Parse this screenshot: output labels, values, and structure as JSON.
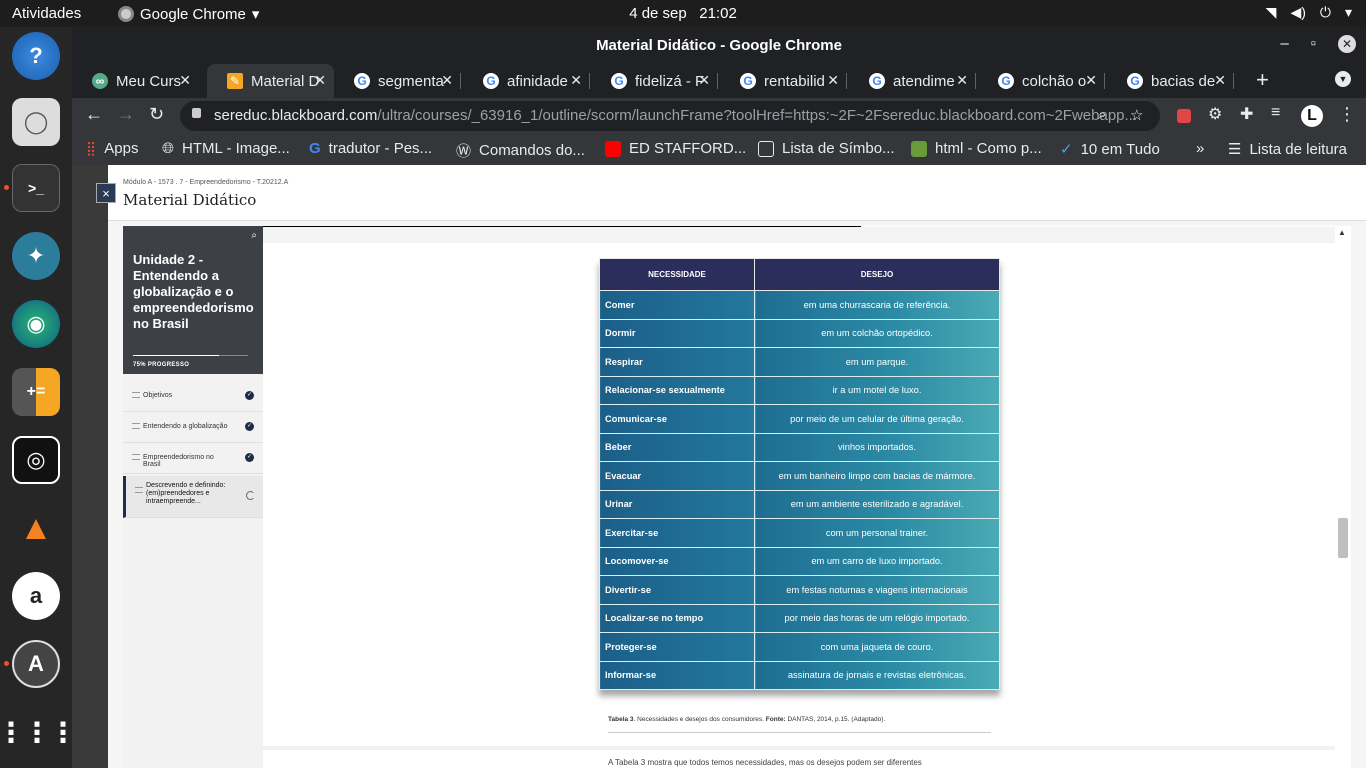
{
  "system": {
    "activities": "Atividades",
    "app_name": "Google Chrome",
    "date": "4 de sep",
    "time": "21:02"
  },
  "window": {
    "title": "Material Didático - Google Chrome"
  },
  "tabs": [
    {
      "label": "Meu Curs"
    },
    {
      "label": "Material D"
    },
    {
      "label": "segmenta"
    },
    {
      "label": "afinidade"
    },
    {
      "label": "fidelizá - F"
    },
    {
      "label": "rentabilid"
    },
    {
      "label": "atendime"
    },
    {
      "label": "colchão o"
    },
    {
      "label": "bacias de"
    }
  ],
  "address": {
    "domain": "sereduc.blackboard.com",
    "path": "/ultra/courses/_63916_1/outline/scorm/launchFrame?toolHref=https:~2F~2Fsereduc.blackboard.com~2Fwebapp..."
  },
  "bookmarks": {
    "apps": "Apps",
    "items": [
      {
        "label": "HTML - Image..."
      },
      {
        "label": "tradutor - Pes..."
      },
      {
        "label": "Comandos do..."
      },
      {
        "label": "ED STAFFORD..."
      },
      {
        "label": "Lista de Símbo..."
      },
      {
        "label": "html - Como p..."
      },
      {
        "label": "10 em Tudo"
      }
    ],
    "overflow": "»",
    "reading_list": "Lista de leitura"
  },
  "panel": {
    "breadcrumb": "Módulo A - 1573 . 7 - Empreendedorismo - T.20212.A",
    "title": "Material Didático",
    "close": "×"
  },
  "sidebar": {
    "unit_title": "Unidade 2 - Entendendo a globalização e o empreendedorismo no Brasil",
    "progress_label": "75% PROGRESSO",
    "progress": 0.75,
    "items": [
      {
        "label": "Objetivos",
        "status": "done"
      },
      {
        "label": "Entendendo a globalização",
        "status": "done"
      },
      {
        "label": "Empreendedorismo no Brasil",
        "status": "done"
      },
      {
        "label": "Descrevendo e definindo: (em)preendedores e intraempreende...",
        "status": "in-progress"
      }
    ]
  },
  "table": {
    "headers": [
      "NECESSIDADE",
      "DESEJO"
    ],
    "rows": [
      [
        "Comer",
        "em uma churrascaria de referência."
      ],
      [
        "Dormir",
        "em um colchão ortopédico."
      ],
      [
        "Respirar",
        "em um parque."
      ],
      [
        "Relacionar-se sexualmente",
        "ir a um motel de luxo."
      ],
      [
        "Comunicar-se",
        "por meio de um celular de última geração."
      ],
      [
        "Beber",
        "vinhos importados."
      ],
      [
        "Evacuar",
        "em um banheiro limpo com bacias de mármore."
      ],
      [
        "Urinar",
        "em um ambiente esterilizado e agradável."
      ],
      [
        "Exercitar-se",
        "com um personal trainer."
      ],
      [
        "Locomover-se",
        "em um carro de luxo importado."
      ],
      [
        "Divertir-se",
        "em festas noturnas e viagens internacionais"
      ],
      [
        "Localizar-se no tempo",
        "por meio das horas de um relógio importado."
      ],
      [
        "Proteger-se",
        "com uma jaqueta de couro."
      ],
      [
        "Informar-se",
        "assinatura de jornais e revistas eletrônicas."
      ]
    ],
    "caption_label": "Tabela 3",
    "caption_text": ". Necessidades e desejos dos consumidores. ",
    "caption_source_label": "Fonte:",
    "caption_source": " DANTAS, 2014, p.15. (Adaptado)."
  },
  "body_text": "A Tabela 3 mostra que todos temos necessidades, mas os desejos podem ser diferentes",
  "colors": {
    "table_header": "#2b2d5a",
    "table_cell": "#2b8aa4",
    "sidebar_card": "#3d4047",
    "accent": "#1f2d4a"
  }
}
